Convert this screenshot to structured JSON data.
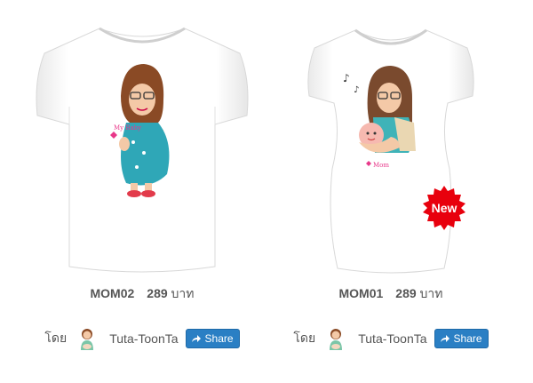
{
  "products": [
    {
      "code": "MOM02",
      "price": "289",
      "currency": "บาท",
      "by_label": "โดย",
      "author": "Tuta-ToonTa",
      "share_label": "Share",
      "badge": null
    },
    {
      "code": "MOM01",
      "price": "289",
      "currency": "บาท",
      "by_label": "โดย",
      "author": "Tuta-ToonTa",
      "share_label": "Share",
      "badge": "New"
    }
  ],
  "colors": {
    "share_button": "#2a7fc4",
    "new_badge": "#e8000d",
    "shirt": "#ffffff",
    "text": "#555555"
  }
}
